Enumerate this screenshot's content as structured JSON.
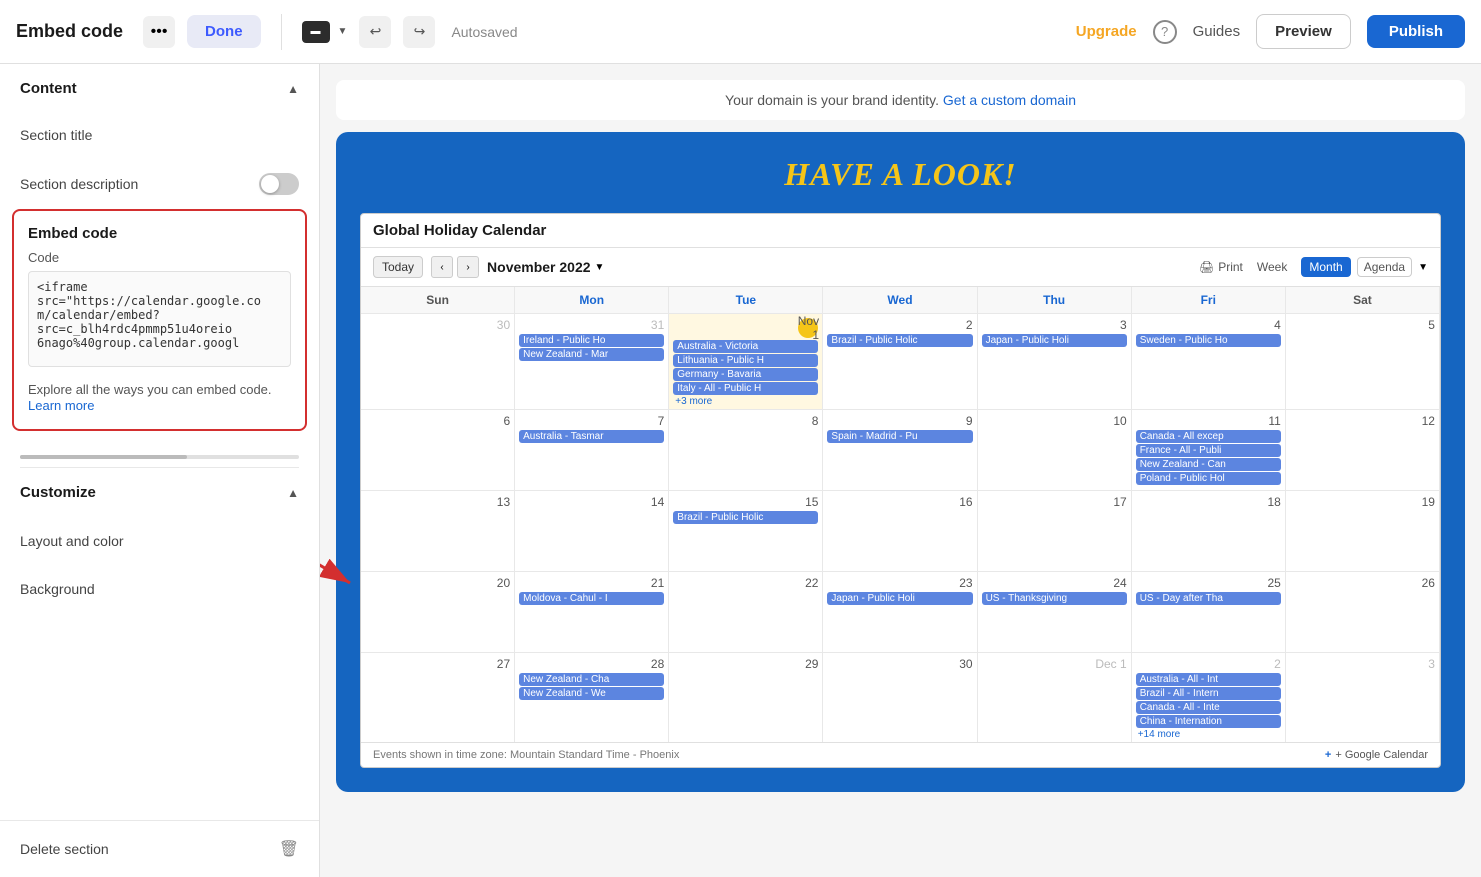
{
  "topbar": {
    "title": "Embed code",
    "done_label": "Done",
    "autosaved": "Autosaved",
    "upgrade_label": "Upgrade",
    "guides_label": "Guides",
    "preview_label": "Preview",
    "publish_label": "Publish"
  },
  "sidebar": {
    "content_label": "Content",
    "section_title_label": "Section title",
    "section_description_label": "Section description",
    "embed_code_title": "Embed code",
    "code_label": "Code",
    "code_value": "<iframe\nsrc=\"https://calendar.google.co\nm/calendar/embed?\nsrc=c_blh4rdc4pmmp51u4oreio\n6nago%40group.calendar.googl",
    "embed_hint": "Explore all the ways you can embed code.",
    "learn_more_label": "Learn more",
    "customize_label": "Customize",
    "layout_color_label": "Layout and color",
    "background_label": "Background",
    "delete_section_label": "Delete section"
  },
  "calendar": {
    "title": "Global Holiday Calendar",
    "nav_today": "Today",
    "month_label": "November 2022",
    "print_label": "Print",
    "view_week": "Week",
    "view_month": "Month",
    "view_agenda": "Agenda",
    "days": [
      "Sun",
      "Mon",
      "Tue",
      "Wed",
      "Thu",
      "Fri",
      "Sat"
    ],
    "footer_tz": "Events shown in time zone: Mountain Standard Time - Phoenix",
    "footer_logo": "+ Google Calendar"
  },
  "section_heading": "HAVE A LOOK!",
  "domain_banner": {
    "text": "Your domain is your brand identity.",
    "link_text": "Get a custom domain"
  }
}
